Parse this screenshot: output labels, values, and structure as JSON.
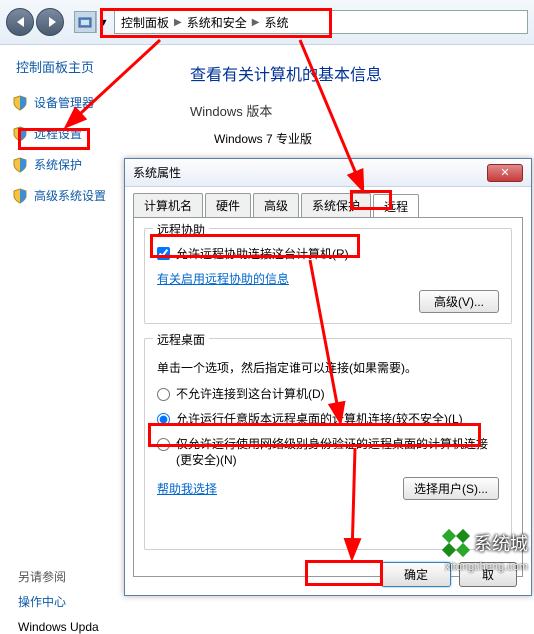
{
  "breadcrumb": {
    "items": [
      "控制面板",
      "系统和安全",
      "系统"
    ]
  },
  "sidebar": {
    "home": "控制面板主页",
    "items": [
      {
        "label": "设备管理器"
      },
      {
        "label": "远程设置"
      },
      {
        "label": "系统保护"
      },
      {
        "label": "高级系统设置"
      }
    ],
    "see_also": "另请参阅",
    "action_center": "操作中心",
    "windows_update": "Windows Upda"
  },
  "content": {
    "title": "查看有关计算机的基本信息",
    "version_heading": "Windows 版本",
    "version_line": "Windows 7 专业版"
  },
  "dialog": {
    "title": "系统属性",
    "close": "✕",
    "tabs": [
      "计算机名",
      "硬件",
      "高级",
      "系统保护",
      "远程"
    ],
    "active_tab": 4,
    "assist": {
      "legend": "远程协助",
      "checkbox_label": "允许远程协助连接这台计算机(R)",
      "info_link": "有关启用远程协助的信息",
      "advanced_btn": "高级(V)..."
    },
    "desktop": {
      "legend": "远程桌面",
      "desc": "单击一个选项，然后指定谁可以连接(如果需要)。",
      "opt1": "不允许连接到这台计算机(D)",
      "opt2": "允许运行任意版本远程桌面的计算机连接(较不安全)(L)",
      "opt3": "仅允许运行使用网络级别身份验证的远程桌面的计算机连接(更安全)(N)",
      "help_link": "帮助我选择",
      "select_users_btn": "选择用户(S)..."
    },
    "buttons": {
      "ok": "确定",
      "cancel": "取"
    }
  },
  "watermark": {
    "text": "系统城",
    "url": "xitongcheng.com"
  }
}
